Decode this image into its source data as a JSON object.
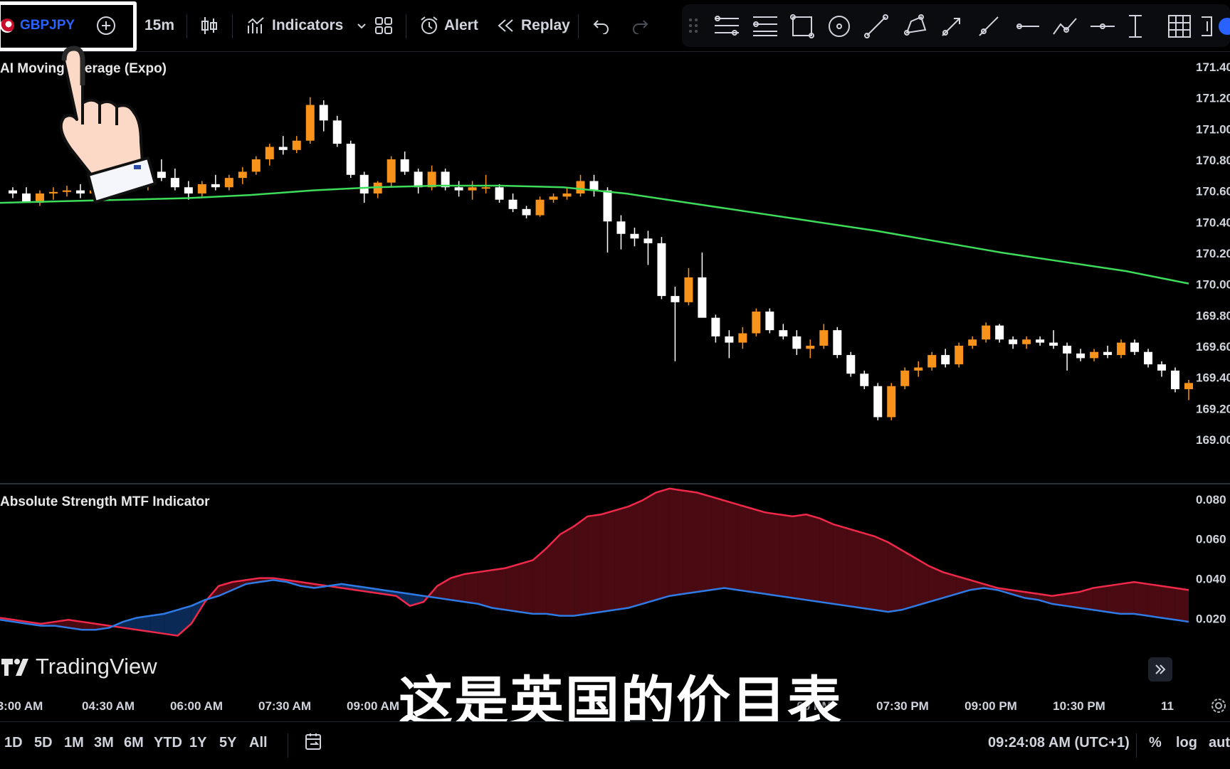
{
  "toolbar": {
    "symbol": "GBPJPY",
    "interval": "15m",
    "indicators_label": "Indicators",
    "alert_label": "Alert",
    "replay_label": "Replay"
  },
  "overlay": {
    "subtitle": "这是英国的价目表",
    "watermark": "TradingView"
  },
  "colors": {
    "up_candle": "#f7931a",
    "down_candle": "#ffffff",
    "ema_line": "#3ddc5a",
    "red_line": "#f0284a",
    "blue_line": "#2f7be6",
    "red_fill": "#4a0a12",
    "blue_fill": "#0a2a55",
    "symbol_text": "#2962ff"
  },
  "chart_data": [
    {
      "type": "candlestick",
      "title": "AI Moving Average (Expo)",
      "ylim": [
        169.0,
        171.45
      ],
      "y_ticks": [
        "171.40",
        "171.20",
        "171.00",
        "170.80",
        "170.60",
        "170.40",
        "170.20",
        "170.00",
        "169.80",
        "169.60",
        "169.40",
        "169.20",
        "169.00"
      ],
      "candles": [
        [
          170.6,
          170.62,
          170.55,
          170.58
        ],
        [
          170.58,
          170.62,
          170.52,
          170.52
        ],
        [
          170.52,
          170.6,
          170.5,
          170.58
        ],
        [
          170.58,
          170.62,
          170.54,
          170.59
        ],
        [
          170.59,
          170.63,
          170.56,
          170.6
        ],
        [
          170.6,
          170.64,
          170.55,
          170.58
        ],
        [
          170.58,
          170.64,
          170.56,
          170.6
        ],
        [
          170.6,
          170.66,
          170.57,
          170.62
        ],
        [
          170.62,
          170.7,
          170.6,
          170.68
        ],
        [
          170.68,
          170.75,
          170.62,
          170.63
        ],
        [
          170.63,
          170.78,
          170.6,
          170.72
        ],
        [
          170.72,
          170.8,
          170.66,
          170.68
        ],
        [
          170.68,
          170.74,
          170.6,
          170.62
        ],
        [
          170.62,
          170.66,
          170.54,
          170.58
        ],
        [
          170.58,
          170.66,
          170.56,
          170.64
        ],
        [
          170.64,
          170.7,
          170.6,
          170.62
        ],
        [
          170.62,
          170.7,
          170.6,
          170.68
        ],
        [
          170.68,
          170.75,
          170.64,
          170.72
        ],
        [
          170.72,
          170.82,
          170.7,
          170.8
        ],
        [
          170.8,
          170.9,
          170.76,
          170.88
        ],
        [
          170.88,
          170.95,
          170.83,
          170.86
        ],
        [
          170.86,
          170.95,
          170.84,
          170.92
        ],
        [
          170.92,
          171.2,
          170.9,
          171.15
        ],
        [
          171.15,
          171.18,
          170.98,
          171.05
        ],
        [
          171.05,
          171.08,
          170.88,
          170.9
        ],
        [
          170.9,
          170.92,
          170.68,
          170.7
        ],
        [
          170.7,
          170.72,
          170.52,
          170.58
        ],
        [
          170.58,
          170.66,
          170.55,
          170.65
        ],
        [
          170.65,
          170.82,
          170.62,
          170.8
        ],
        [
          170.8,
          170.85,
          170.7,
          170.72
        ],
        [
          170.72,
          170.74,
          170.58,
          170.62
        ],
        [
          170.62,
          170.76,
          170.6,
          170.72
        ],
        [
          170.72,
          170.74,
          170.6,
          170.62
        ],
        [
          170.62,
          170.66,
          170.56,
          170.6
        ],
        [
          170.6,
          170.66,
          170.54,
          170.62
        ],
        [
          170.62,
          170.7,
          170.58,
          170.62
        ],
        [
          170.62,
          170.64,
          170.52,
          170.54
        ],
        [
          170.54,
          170.58,
          170.46,
          170.48
        ],
        [
          170.48,
          170.5,
          170.42,
          170.44
        ],
        [
          170.44,
          170.56,
          170.43,
          170.54
        ],
        [
          170.54,
          170.58,
          170.52,
          170.56
        ],
        [
          170.56,
          170.62,
          170.54,
          170.58
        ],
        [
          170.58,
          170.7,
          170.56,
          170.66
        ],
        [
          170.66,
          170.7,
          170.56,
          170.6
        ],
        [
          170.6,
          170.62,
          170.2,
          170.4
        ],
        [
          170.4,
          170.44,
          170.22,
          170.32
        ],
        [
          170.32,
          170.36,
          170.24,
          170.29
        ],
        [
          170.29,
          170.34,
          170.12,
          170.26
        ],
        [
          170.26,
          170.3,
          169.9,
          169.92
        ],
        [
          169.92,
          169.98,
          169.5,
          169.88
        ],
        [
          169.88,
          170.1,
          169.86,
          170.04
        ],
        [
          170.04,
          170.2,
          169.78,
          169.78
        ],
        [
          169.78,
          169.8,
          169.62,
          169.66
        ],
        [
          169.66,
          169.7,
          169.52,
          169.62
        ],
        [
          169.62,
          169.72,
          169.58,
          169.68
        ],
        [
          169.68,
          169.84,
          169.66,
          169.82
        ],
        [
          169.82,
          169.84,
          169.68,
          169.7
        ],
        [
          169.7,
          169.74,
          169.64,
          169.66
        ],
        [
          169.66,
          169.7,
          169.54,
          169.58
        ],
        [
          169.58,
          169.64,
          169.52,
          169.6
        ],
        [
          169.6,
          169.74,
          169.58,
          169.7
        ],
        [
          169.7,
          169.72,
          169.52,
          169.54
        ],
        [
          169.54,
          169.56,
          169.4,
          169.42
        ],
        [
          169.42,
          169.44,
          169.32,
          169.34
        ],
        [
          169.34,
          169.36,
          169.12,
          169.14
        ],
        [
          169.14,
          169.36,
          169.12,
          169.34
        ],
        [
          169.34,
          169.46,
          169.32,
          169.44
        ],
        [
          169.44,
          169.5,
          169.4,
          169.46
        ],
        [
          169.46,
          169.56,
          169.44,
          169.54
        ],
        [
          169.54,
          169.58,
          169.46,
          169.48
        ],
        [
          169.48,
          169.62,
          169.46,
          169.6
        ],
        [
          169.6,
          169.66,
          169.58,
          169.64
        ],
        [
          169.64,
          169.75,
          169.62,
          169.73
        ],
        [
          169.73,
          169.74,
          169.62,
          169.64
        ],
        [
          169.64,
          169.66,
          169.58,
          169.61
        ],
        [
          169.61,
          169.66,
          169.58,
          169.64
        ],
        [
          169.64,
          169.66,
          169.6,
          169.62
        ],
        [
          169.62,
          169.7,
          169.58,
          169.6
        ],
        [
          169.6,
          169.62,
          169.44,
          169.55
        ],
        [
          169.55,
          169.58,
          169.5,
          169.52
        ],
        [
          169.52,
          169.58,
          169.5,
          169.56
        ],
        [
          169.56,
          169.6,
          169.52,
          169.54
        ],
        [
          169.54,
          169.64,
          169.52,
          169.62
        ],
        [
          169.62,
          169.64,
          169.54,
          169.56
        ],
        [
          169.56,
          169.58,
          169.46,
          169.48
        ],
        [
          169.48,
          169.5,
          169.4,
          169.44
        ],
        [
          169.44,
          169.46,
          169.3,
          169.32
        ],
        [
          169.32,
          169.38,
          169.25,
          169.36
        ]
      ],
      "ema": [
        170.52,
        170.53,
        170.54,
        170.55,
        170.57,
        170.6,
        170.62,
        170.63,
        170.63,
        170.62,
        170.58,
        170.52,
        170.46,
        170.4,
        170.34,
        170.27,
        170.2,
        170.14,
        170.08,
        170.0
      ],
      "x_ticks": [
        "3:00 AM",
        "04:30 AM",
        "06:00 AM",
        "07:30 AM",
        "09:00 AM",
        "",
        "",
        "",
        "",
        "00 PM",
        "07:30 PM",
        "09:00 PM",
        "10:30 PM",
        "11"
      ]
    },
    {
      "type": "area",
      "title": "Absolute Strength MTF Indicator",
      "ylim": [
        0.008,
        0.086
      ],
      "y_ticks": [
        "0.080",
        "0.060",
        "0.040",
        "0.020"
      ],
      "series": [
        {
          "values": [
            0.02,
            0.019,
            0.018,
            0.017,
            0.018,
            0.019,
            0.018,
            0.017,
            0.016,
            0.015,
            0.014,
            0.013,
            0.012,
            0.011,
            0.017,
            0.028,
            0.036,
            0.038,
            0.039,
            0.04,
            0.04,
            0.039,
            0.038,
            0.037,
            0.036,
            0.035,
            0.034,
            0.033,
            0.032,
            0.031,
            0.026,
            0.028,
            0.036,
            0.04,
            0.042,
            0.043,
            0.044,
            0.045,
            0.047,
            0.049,
            0.055,
            0.062,
            0.066,
            0.071,
            0.072,
            0.074,
            0.076,
            0.079,
            0.083,
            0.085,
            0.084,
            0.083,
            0.081,
            0.079,
            0.077,
            0.075,
            0.073,
            0.072,
            0.071,
            0.072,
            0.07,
            0.067,
            0.065,
            0.063,
            0.061,
            0.058,
            0.054,
            0.05,
            0.046,
            0.043,
            0.041,
            0.039,
            0.037,
            0.035,
            0.034,
            0.033,
            0.032,
            0.031,
            0.032,
            0.033,
            0.035,
            0.036,
            0.037,
            0.038,
            0.037,
            0.036,
            0.035,
            0.034
          ]
        },
        {
          "values": [
            0.019,
            0.018,
            0.017,
            0.016,
            0.016,
            0.015,
            0.014,
            0.014,
            0.015,
            0.018,
            0.02,
            0.021,
            0.022,
            0.024,
            0.026,
            0.029,
            0.031,
            0.034,
            0.037,
            0.038,
            0.039,
            0.038,
            0.036,
            0.035,
            0.036,
            0.037,
            0.036,
            0.035,
            0.034,
            0.033,
            0.032,
            0.031,
            0.03,
            0.029,
            0.028,
            0.027,
            0.025,
            0.024,
            0.023,
            0.022,
            0.022,
            0.021,
            0.021,
            0.022,
            0.023,
            0.024,
            0.025,
            0.027,
            0.029,
            0.031,
            0.032,
            0.033,
            0.034,
            0.035,
            0.034,
            0.033,
            0.032,
            0.031,
            0.03,
            0.029,
            0.028,
            0.027,
            0.026,
            0.025,
            0.024,
            0.023,
            0.024,
            0.026,
            0.028,
            0.03,
            0.032,
            0.034,
            0.035,
            0.034,
            0.032,
            0.03,
            0.029,
            0.027,
            0.026,
            0.025,
            0.024,
            0.023,
            0.022,
            0.022,
            0.021,
            0.02,
            0.019,
            0.018
          ]
        }
      ]
    }
  ],
  "bottombar": {
    "ranges": [
      "1D",
      "5D",
      "1M",
      "3M",
      "6M",
      "YTD",
      "1Y",
      "5Y",
      "All"
    ],
    "clock": "09:24:08 AM (UTC+1)",
    "percent_label": "%",
    "log_label": "log",
    "auto_label": "aut"
  }
}
